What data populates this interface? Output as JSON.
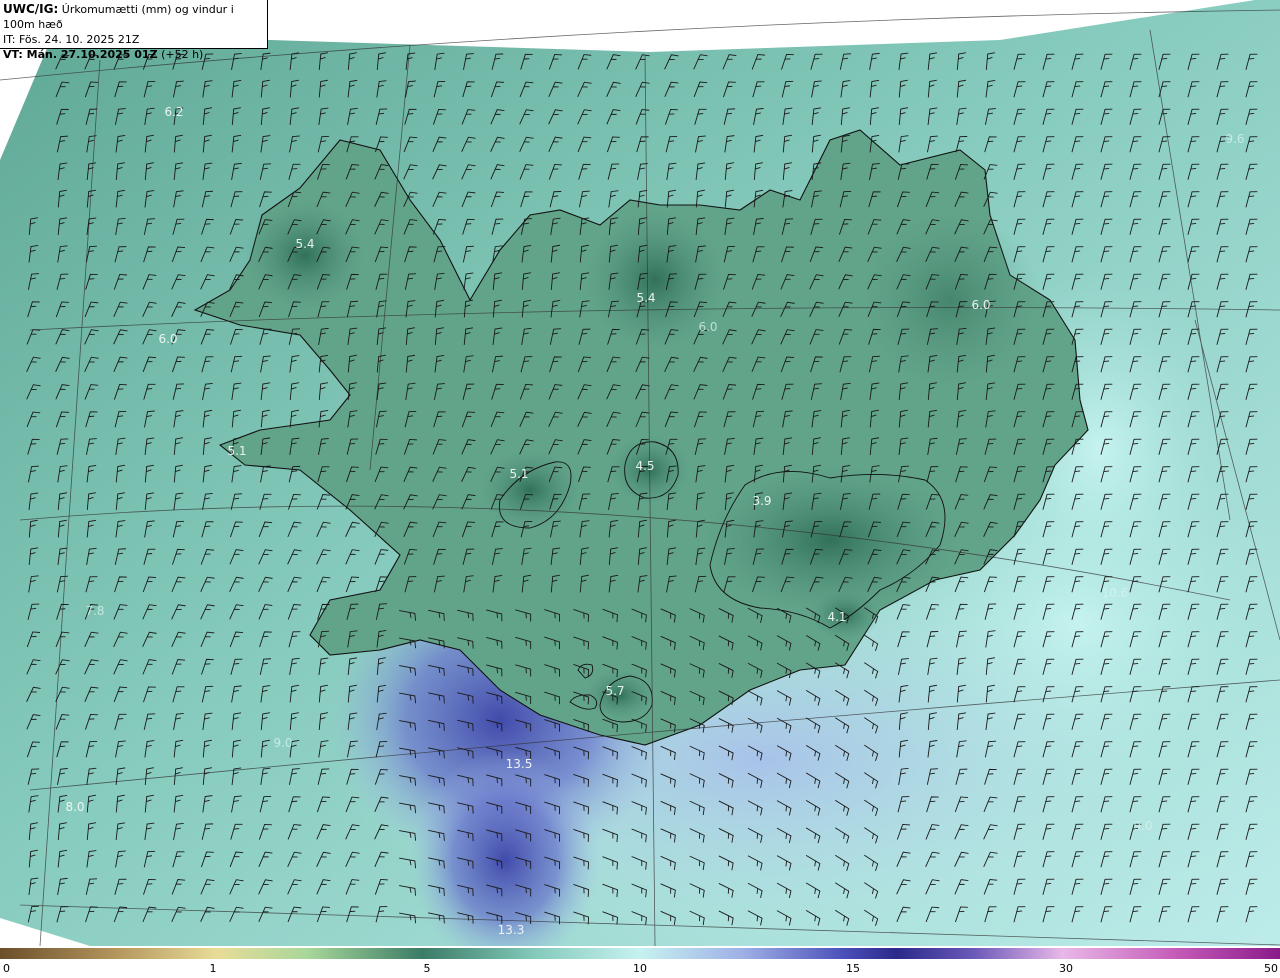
{
  "header": {
    "model": "UWC/IG:",
    "title": "Úrkomumætti (mm) og vindur i 100m hæð",
    "initial_time": "IT: Fös. 24. 10. 2025 21Z",
    "valid_prefix": "VT: Mán. 27.10.2025 01Z",
    "valid_suffix": "(+52 h)"
  },
  "value_labels": [
    {
      "text": "6.2",
      "tone": "light"
    },
    {
      "text": "5.4",
      "tone": "light"
    },
    {
      "text": "5.4",
      "tone": "light"
    },
    {
      "text": "6.0",
      "tone": "light"
    },
    {
      "text": "6.0",
      "tone": "light"
    },
    {
      "text": "5.1",
      "tone": "light"
    },
    {
      "text": "5.1",
      "tone": "light"
    },
    {
      "text": "4.5",
      "tone": "light"
    },
    {
      "text": "3.9",
      "tone": "light"
    },
    {
      "text": "4.1",
      "tone": "light"
    },
    {
      "text": "5.7",
      "tone": "light"
    },
    {
      "text": "13.5",
      "tone": "light"
    },
    {
      "text": "13.3",
      "tone": "light"
    },
    {
      "text": "8.0",
      "tone": "light"
    },
    {
      "text": "9.0",
      "tone": "faint"
    },
    {
      "text": "9.6",
      "tone": "faint"
    },
    {
      "text": "6.0",
      "tone": "faint"
    },
    {
      "text": "7.8",
      "tone": "faint"
    },
    {
      "text": "10.6",
      "tone": "faint"
    },
    {
      "text": "9.0",
      "tone": "faint"
    }
  ],
  "colorbar": {
    "ticks": [
      "0",
      "1",
      "2",
      "5",
      "10",
      "15",
      "30",
      "50"
    ],
    "shown_ticks": [
      "0",
      "1",
      "5",
      "10",
      "15",
      "30",
      "50"
    ]
  },
  "colors": {
    "sea_base": "#7fc6b6",
    "land_dark": "#3f7f68",
    "land_mid": "#5e9f86",
    "precip_light": "#bff0ef",
    "precip_blue": "#6a78cc",
    "precip_deep": "#3c43a8",
    "coast": "#111111",
    "barb": "#1a1a1a"
  }
}
